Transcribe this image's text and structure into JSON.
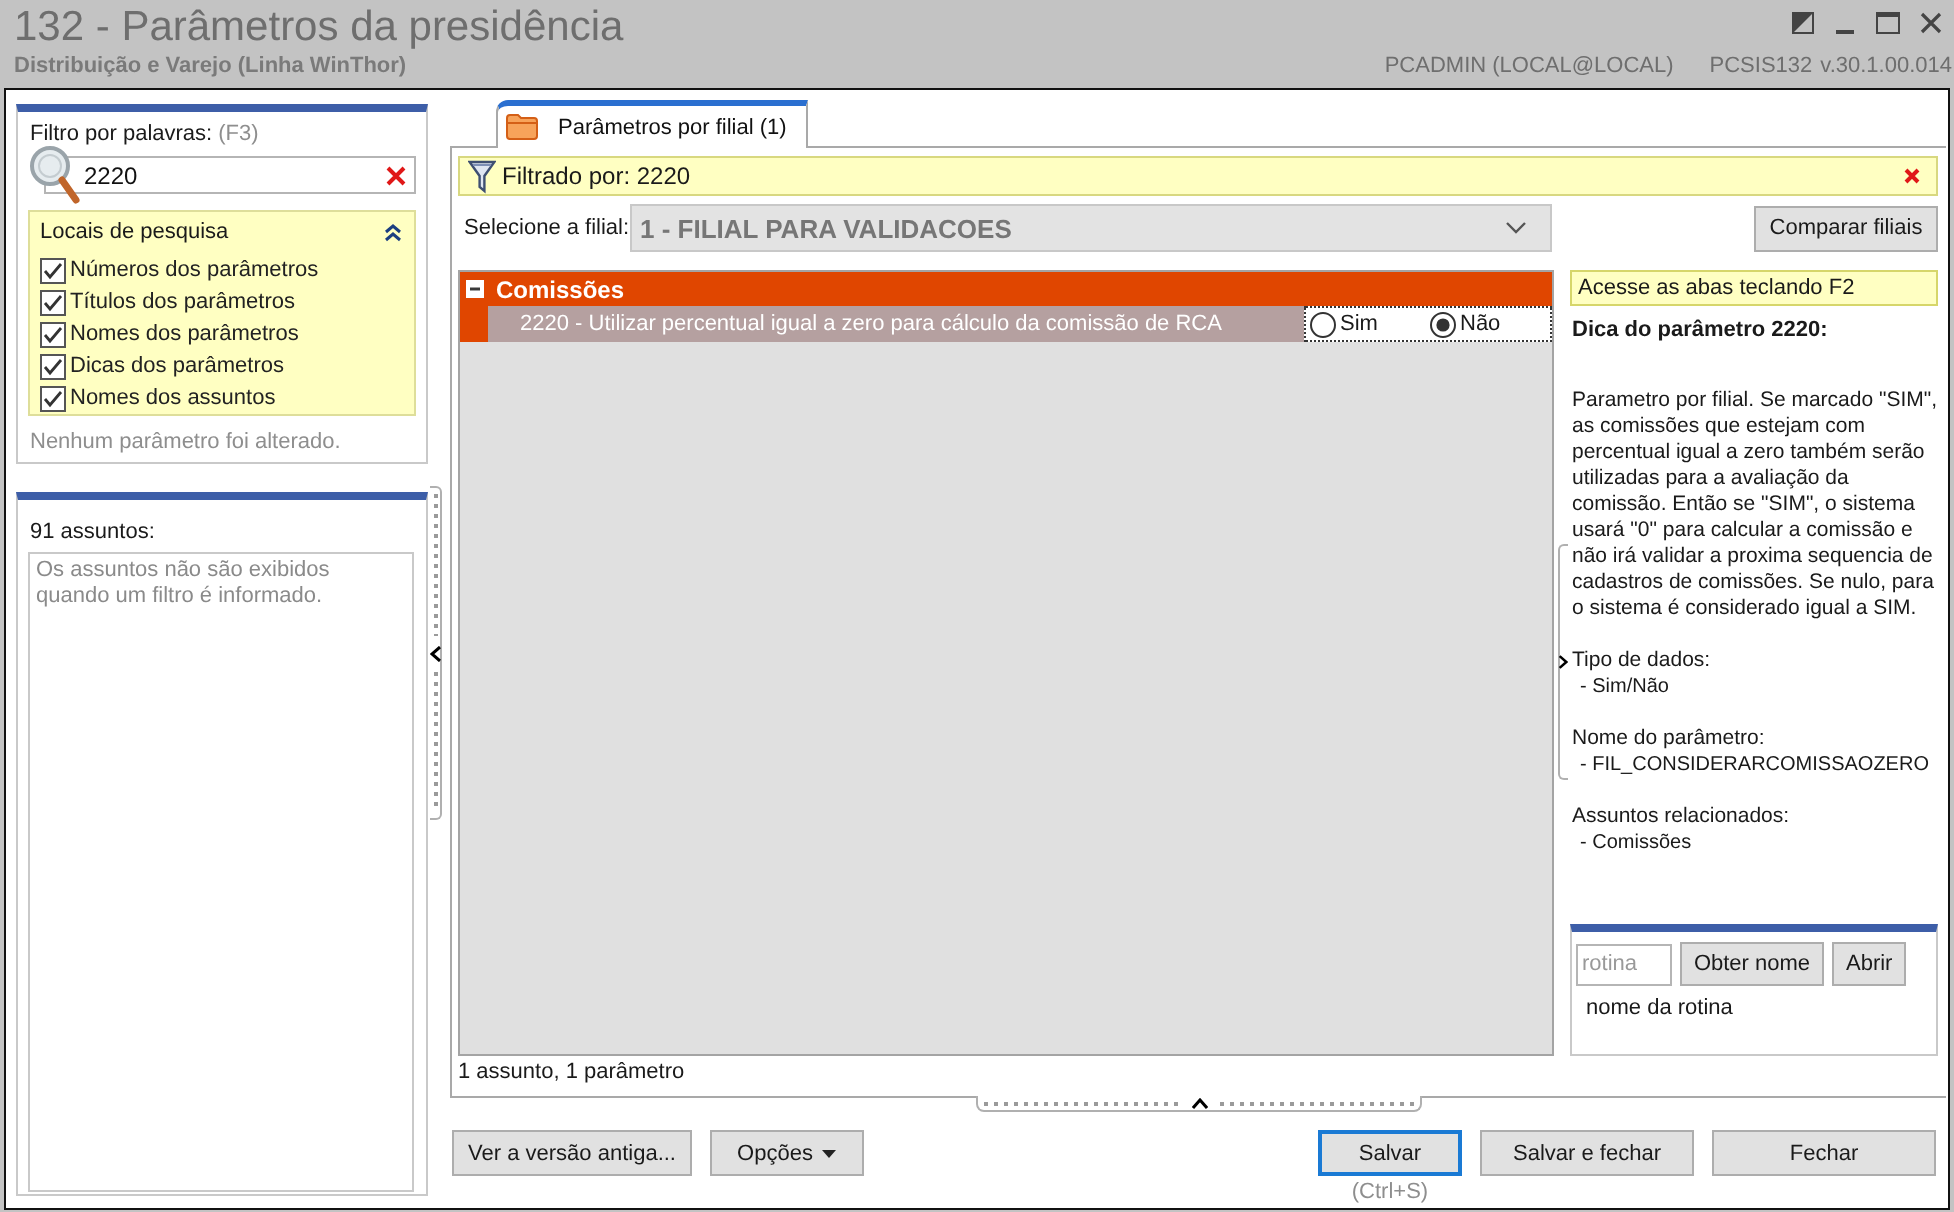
{
  "window": {
    "title": "132 - Parâmetros da presidência",
    "subtitle": "Distribuição e Varejo (Linha WinThor)",
    "user": "PCADMIN (LOCAL@LOCAL)",
    "program": "PCSIS132",
    "version": "v.30.1.00.014"
  },
  "filter_panel": {
    "label": "Filtro por palavras:",
    "shortcut": "(F3)",
    "search": {
      "value": "2220"
    },
    "search_locations": {
      "title": "Locais de pesquisa",
      "expanded": true,
      "options": [
        {
          "label": "Números dos parâmetros",
          "checked": true
        },
        {
          "label": "Títulos dos parâmetros",
          "checked": true
        },
        {
          "label": "Nomes dos parâmetros",
          "checked": true
        },
        {
          "label": "Dicas dos parâmetros",
          "checked": true
        },
        {
          "label": "Nomes dos assuntos",
          "checked": true
        }
      ]
    },
    "status": "Nenhum parâmetro foi alterado."
  },
  "subjects_panel": {
    "title": "91 assuntos:",
    "message": "Os assuntos não são exibidos quando um filtro é informado."
  },
  "tabs": [
    {
      "label": "Parâmetros por filial (1)",
      "selected": true
    }
  ],
  "filter_bar": {
    "text": "Filtrado por: 2220"
  },
  "branch": {
    "label": "Selecione a filial:",
    "value": "1 - FILIAL PARA VALIDACOES",
    "disabled": true,
    "compare_button": "Comparar filiais"
  },
  "parameters": {
    "groups": [
      {
        "title": "Comissões",
        "expanded": true,
        "children": [
          {
            "label": "2220 - Utilizar percentual igual a zero para cálculo da comissão de RCA",
            "selected": true,
            "options": [
              {
                "label": "Sim",
                "selected": false
              },
              {
                "label": "Não",
                "selected": true
              }
            ]
          }
        ]
      }
    ]
  },
  "hint_panel": {
    "shortcut_hint": "Acesse as abas teclando F2",
    "title": "Dica do parâmetro 2220:",
    "description": "Parametro por filial. Se marcado \"SIM\", as comissões que estejam com percentual igual a zero também serão utilizadas para a avaliação da comissão. Então se \"SIM\", o sistema usará \"0\" para calcular a comissão e não irá validar a proxima sequencia de cadastros de comissões. Se nulo, para o sistema é considerado igual a SIM.",
    "sections": [
      {
        "heading": "Tipo de dados:",
        "items": [
          "- Sim/Não"
        ]
      },
      {
        "heading": "Nome do parâmetro:",
        "items": [
          "- FIL_CONSIDERARCOMISSAOZERO"
        ]
      },
      {
        "heading": "Assuntos relacionados:",
        "items": [
          "- Comissões"
        ]
      }
    ]
  },
  "routine_lookup": {
    "input": {
      "placeholder": "rotina"
    },
    "buttons": [
      "Obter nome",
      "Abrir"
    ],
    "result": "nome da rotina"
  },
  "status_bar": "1 assunto, 1 parâmetro",
  "footer": {
    "left_buttons": [
      {
        "label": "Ver a versão antiga...",
        "kind": "plain"
      },
      {
        "label": "Opções",
        "kind": "menu"
      }
    ],
    "right_buttons": [
      {
        "label": "Salvar",
        "kind": "default",
        "shortcut": "(Ctrl+S)"
      },
      {
        "label": "Salvar e fechar",
        "kind": "plain"
      },
      {
        "label": "Fechar",
        "kind": "plain"
      }
    ]
  }
}
